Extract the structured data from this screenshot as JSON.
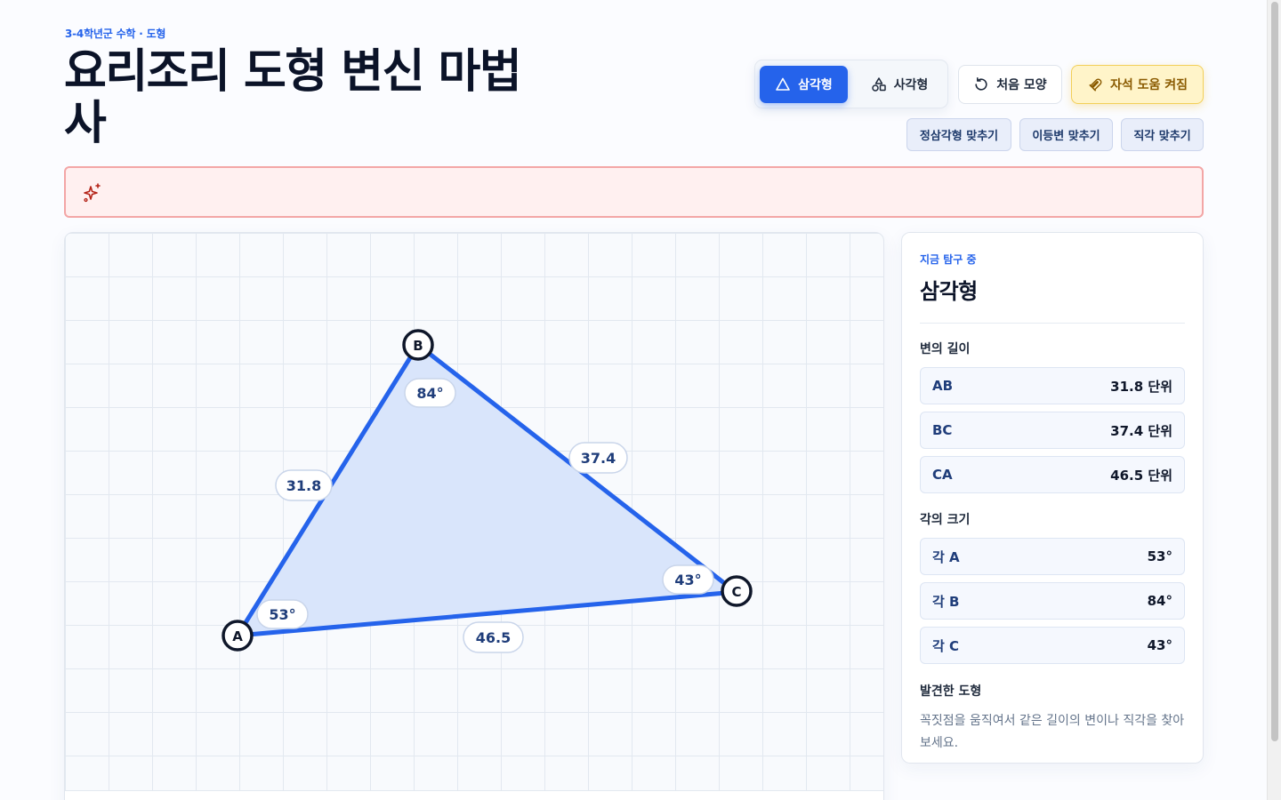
{
  "header": {
    "eyebrow": "3-4학년군 수학 · 도형",
    "title": "요리조리 도형 변신 마법사"
  },
  "toolbar": {
    "modes": [
      {
        "label": "삼각형",
        "icon": "triangle-icon",
        "active": true
      },
      {
        "label": "사각형",
        "icon": "shapes-icon",
        "active": false
      }
    ],
    "reset_label": "처음 모양",
    "magnet_label": "자석 도움 켜짐",
    "chips": [
      "정삼각형 맞추기",
      "이등변 맞추기",
      "직각 맞추기"
    ]
  },
  "alert": {
    "icon": "sparkles-icon",
    "text": ""
  },
  "canvas": {
    "vertices": [
      "A",
      "B",
      "C"
    ],
    "edge_labels": {
      "AB": "31.8",
      "BC": "37.4",
      "CA": "46.5"
    },
    "angle_labels": {
      "A": "53°",
      "B": "84°",
      "C": "43°"
    }
  },
  "panel": {
    "eyebrow": "지금 탐구 중",
    "title": "삼각형",
    "sides_label": "변의 길이",
    "sides": [
      {
        "name": "AB",
        "value": "31.8 단위"
      },
      {
        "name": "BC",
        "value": "37.4 단위"
      },
      {
        "name": "CA",
        "value": "46.5 단위"
      }
    ],
    "angles_label": "각의 크기",
    "angles": [
      {
        "name": "각 A",
        "value": "53°"
      },
      {
        "name": "각 B",
        "value": "84°"
      },
      {
        "name": "각 C",
        "value": "43°"
      }
    ],
    "found_label": "발견한 도형",
    "found_text": "꼭짓점을 움직여서 같은 길이의 변이나 직각을 찾아보세요."
  },
  "colors": {
    "accent": "#2563eb",
    "triangle_fill": "#dbe6fb",
    "magnet_bg": "#fff4c9",
    "alert_bg": "#fff0f0",
    "alert_border": "#f3a6a6"
  }
}
